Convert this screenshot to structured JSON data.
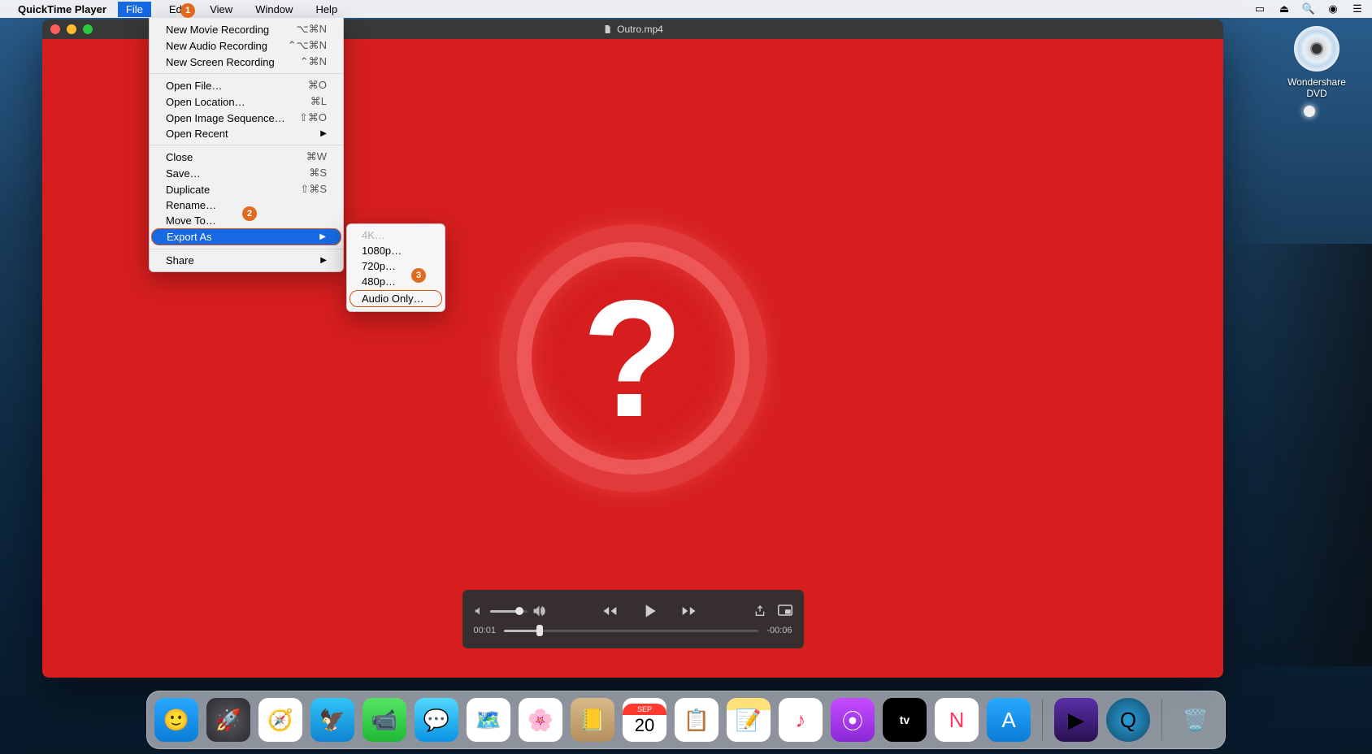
{
  "menubar": {
    "app": "QuickTime Player",
    "items": [
      "File",
      "Edit",
      "View",
      "Window",
      "Help"
    ]
  },
  "status_icons": [
    "airplay-icon",
    "eject-icon",
    "search-icon",
    "siri-icon",
    "menu-icon"
  ],
  "file_menu": [
    {
      "label": "New Movie Recording",
      "shortcut": "⌥⌘N"
    },
    {
      "label": "New Audio Recording",
      "shortcut": "⌃⌥⌘N"
    },
    {
      "label": "New Screen Recording",
      "shortcut": "⌃⌘N"
    },
    {
      "sep": true
    },
    {
      "label": "Open File…",
      "shortcut": "⌘O"
    },
    {
      "label": "Open Location…",
      "shortcut": "⌘L"
    },
    {
      "label": "Open Image Sequence…",
      "shortcut": "⇧⌘O"
    },
    {
      "label": "Open Recent",
      "arrow": true
    },
    {
      "sep": true
    },
    {
      "label": "Close",
      "shortcut": "⌘W"
    },
    {
      "label": "Save…",
      "shortcut": "⌘S"
    },
    {
      "label": "Duplicate",
      "shortcut": "⇧⌘S"
    },
    {
      "label": "Rename…"
    },
    {
      "label": "Move To…"
    },
    {
      "label": "Export As",
      "arrow": true,
      "highlight": true
    },
    {
      "sep": true
    },
    {
      "label": "Share",
      "arrow": true
    }
  ],
  "export_submenu": [
    {
      "label": "4K…",
      "disabled": true
    },
    {
      "label": "1080p…"
    },
    {
      "label": "720p…"
    },
    {
      "label": "480p…"
    },
    {
      "label": "Audio Only…",
      "boxed": true
    }
  ],
  "badges": {
    "b1": "1",
    "b2": "2",
    "b3": "3"
  },
  "window": {
    "title": "Outro.mp4"
  },
  "player": {
    "left_time": "00:01",
    "right_time": "-00:06"
  },
  "desktop_icon": {
    "label": "Wondershare DVD"
  },
  "calendar": {
    "month": "SEP",
    "day": "20"
  },
  "atv_label": "tv"
}
